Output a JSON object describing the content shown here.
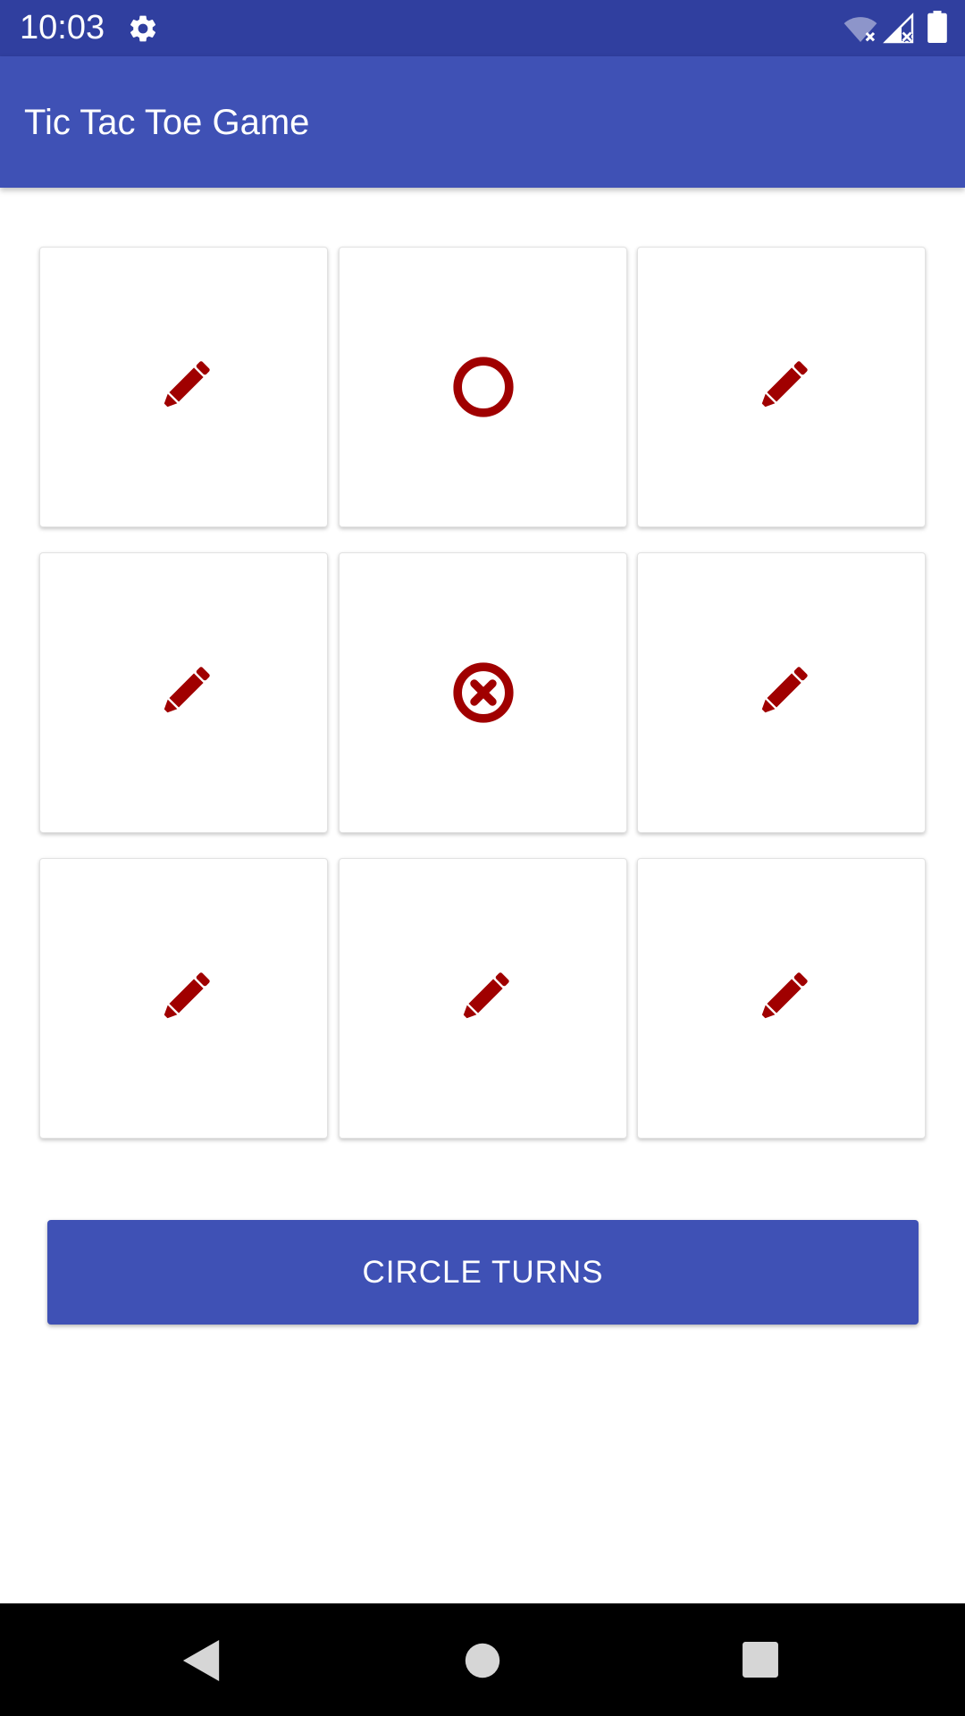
{
  "status_bar": {
    "time": "10:03",
    "icons": [
      "gear-icon",
      "wifi-off-icon",
      "signal-off-icon",
      "battery-icon"
    ]
  },
  "app_bar": {
    "title": "Tic Tac Toe Game"
  },
  "board": {
    "cells": [
      {
        "state": "empty",
        "icon": "pencil-icon"
      },
      {
        "state": "circle",
        "icon": "circle-icon"
      },
      {
        "state": "empty",
        "icon": "pencil-icon"
      },
      {
        "state": "empty",
        "icon": "pencil-icon"
      },
      {
        "state": "cross",
        "icon": "cross-circle-icon"
      },
      {
        "state": "empty",
        "icon": "pencil-icon"
      },
      {
        "state": "empty",
        "icon": "pencil-icon"
      },
      {
        "state": "empty",
        "icon": "pencil-icon"
      },
      {
        "state": "empty",
        "icon": "pencil-icon"
      }
    ]
  },
  "turn_button": {
    "label": "CIRCLE TURNS"
  },
  "nav_bar": {
    "icons": [
      "back-icon",
      "home-icon",
      "recent-apps-icon"
    ]
  },
  "colors": {
    "status_bar": "#303f9f",
    "app_bar": "#3f51b5",
    "icon": "#a00000",
    "button": "#3f51b5"
  }
}
